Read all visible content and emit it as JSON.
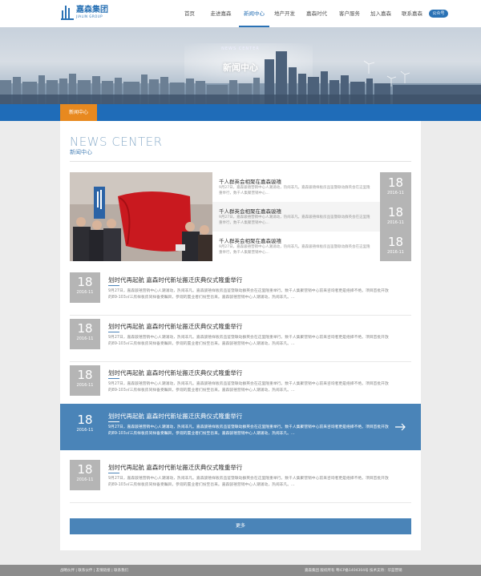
{
  "header": {
    "logo_cn": "嘉森集团",
    "logo_en": "JIALIN GROUP",
    "nav": [
      {
        "label": "首页",
        "active": false
      },
      {
        "label": "走进嘉森",
        "active": false
      },
      {
        "label": "新闻中心",
        "active": true
      },
      {
        "label": "地产开发",
        "active": false
      },
      {
        "label": "嘉森时代",
        "active": false
      },
      {
        "label": "客户服务",
        "active": false
      },
      {
        "label": "加入嘉森",
        "active": false
      },
      {
        "label": "联系嘉森",
        "active": false
      }
    ],
    "wechat_label": "公众号"
  },
  "banner": {
    "title_en": "NEWS CENTER",
    "title_cn": "新闻中心"
  },
  "breadcrumb": {
    "label": "新闻中心"
  },
  "section": {
    "title_en": "NEWS CENTER",
    "title_cn": "新闻中心"
  },
  "featured": [
    {
      "title": "千人群英会相聚在嘉森骏禧",
      "desc": "9月27日，嘉森骏禧营销中心人潮涌动，热闹非凡。嘉森骏禧样板房品鉴暨联动群英会在这里隆重举行，数千人集聚营销中心...",
      "day": "18",
      "ym": "2016-11"
    },
    {
      "title": "千人群英会相聚在嘉森骏禧",
      "desc": "9月27日，嘉森骏禧营销中心人潮涌动，热闹非凡。嘉森骏禧样板房品鉴暨联动群英会在这里隆重举行，数千人集聚营销中心...",
      "day": "18",
      "ym": "2016-11"
    },
    {
      "title": "千人群英会相聚在嘉森骏禧",
      "desc": "9月27日，嘉森骏禧营销中心人潮涌动，热闹非凡。嘉森骏禧样板房品鉴暨联动群英会在这里隆重举行，数千人集聚营销中心...",
      "day": "18",
      "ym": "2016-11"
    }
  ],
  "news": [
    {
      "title": "划时代再起航 嘉森时代新址搬迁庆典仪式隆重举行",
      "desc": "9月27日，嘉森骏禧营销中心人潮涌动，热闹非凡。嘉森骏禧样板房品鉴暨联动群英会在这里隆重举行。数千人集聚营销中心前来咨询者更是络绎不绝。项目首批开放的89-103㎡三房样板房同样备受瞩目，参观的置业者们纷至沓来。嘉森骏禧营销中心人潮涌动，热闹非凡。...",
      "day": "18",
      "ym": "2016-11",
      "highlight": false
    },
    {
      "title": "划时代再起航 嘉森时代新址搬迁庆典仪式隆重举行",
      "desc": "9月27日，嘉森骏禧营销中心人潮涌动，热闹非凡。嘉森骏禧样板房品鉴暨联动群英会在这里隆重举行。数千人集聚营销中心前来咨询者更是络绎不绝。项目首批开放的89-103㎡三房样板房同样备受瞩目，参观的置业者们纷至沓来。嘉森骏禧营销中心人潮涌动，热闹非凡。...",
      "day": "18",
      "ym": "2016-11",
      "highlight": false
    },
    {
      "title": "划时代再起航 嘉森时代新址搬迁庆典仪式隆重举行",
      "desc": "9月27日，嘉森骏禧营销中心人潮涌动，热闹非凡。嘉森骏禧样板房品鉴暨联动群英会在这里隆重举行。数千人集聚营销中心前来咨询者更是络绎不绝。项目首批开放的89-103㎡三房样板房同样备受瞩目，参观的置业者们纷至沓来。嘉森骏禧营销中心人潮涌动，热闹非凡。...",
      "day": "18",
      "ym": "2016-11",
      "highlight": false
    },
    {
      "title": "划时代再起航 嘉森时代新址搬迁庆典仪式隆重举行",
      "desc": "9月27日，嘉森骏禧营销中心人潮涌动，热闹非凡。嘉森骏禧样板房品鉴暨联动群英会在这里隆重举行。数千人集聚营销中心前来咨询者更是络绎不绝。项目首批开放的89-103㎡三房样板房同样备受瞩目，参观的置业者们纷至沓来。嘉森骏禧营销中心人潮涌动，热闹非凡。...",
      "day": "18",
      "ym": "2016-11",
      "highlight": true
    },
    {
      "title": "划时代再起航 嘉森时代新址搬迁庆典仪式隆重举行",
      "desc": "9月27日，嘉森骏禧营销中心人潮涌动，热闹非凡。嘉森骏禧样板房品鉴暨联动群英会在这里隆重举行。数千人集聚营销中心前来咨询者更是络绎不绝。项目首批开放的89-103㎡三房样板房同样备受瞩目，参观的置业者们纷至沓来。嘉森骏禧营销中心人潮涌动，热闹非凡。...",
      "day": "18",
      "ym": "2016-11",
      "highlight": false
    }
  ],
  "more_label": "更多",
  "footer": {
    "left": "战略伙伴 | 联系伙伴 | 友情链接 | 联系我们",
    "right": "嘉森集团 版权所有    粤ICP备1404304号    技术支持：华蓝营销"
  },
  "colors": {
    "brand": "#2a72b5",
    "accent": "#e8891f",
    "highlight": "#4a84b8"
  }
}
